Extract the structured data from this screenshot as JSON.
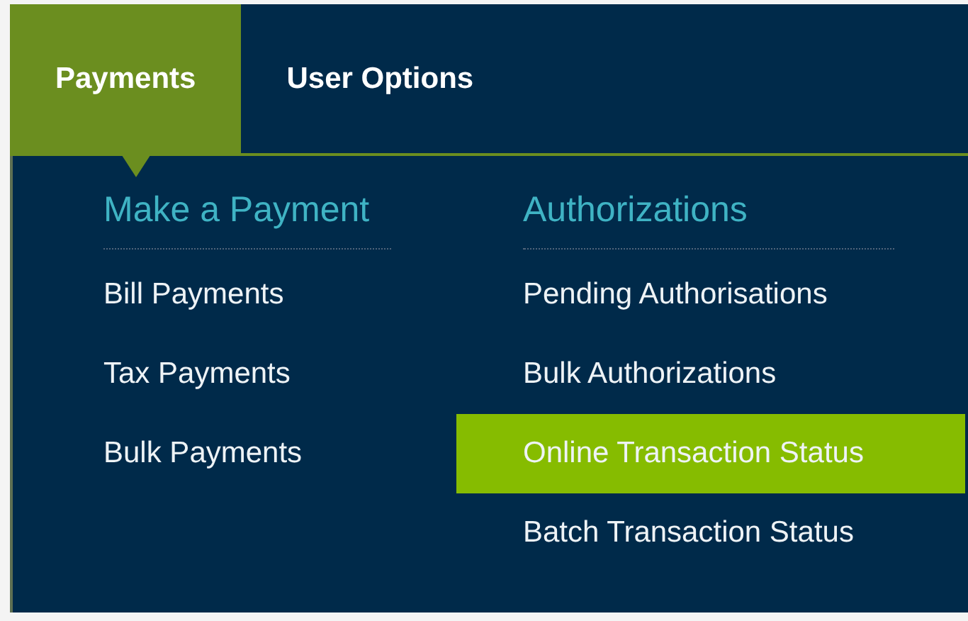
{
  "tabs": [
    {
      "label": "Payments",
      "selected": true
    },
    {
      "label": "User Options",
      "selected": false
    }
  ],
  "columns": [
    {
      "heading": "Make a Payment",
      "items": [
        {
          "label": "Bill Payments",
          "selected": false
        },
        {
          "label": "Tax Payments",
          "selected": false
        },
        {
          "label": "Bulk Payments",
          "selected": false
        }
      ]
    },
    {
      "heading": "Authorizations",
      "items": [
        {
          "label": "Pending Authorisations",
          "selected": false
        },
        {
          "label": "Bulk Authorizations",
          "selected": false
        },
        {
          "label": "Online Transaction Status",
          "selected": true
        },
        {
          "label": "Batch Transaction Status",
          "selected": false
        }
      ]
    }
  ]
}
